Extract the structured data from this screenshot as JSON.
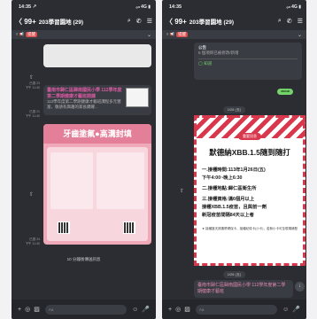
{
  "left": {
    "status_time": "14:35 ↗",
    "status_right": "ₒₗₗ 4G ▮",
    "header": {
      "back": "〈 99+",
      "title": "203學習園地 (29)",
      "search": "⌕",
      "call": "✆",
      "menu": "☰"
    },
    "notice": {
      "text": "▿ 📢",
      "tag": "提醒",
      "chevron": "⌄"
    },
    "ts1": "已讀 23\n下午 11:40",
    "news": {
      "title": "臺南市歸仁區歸南國民小學 112學年度第二學期健康才藝班開課",
      "body": "112學年度第二學期健康才藝班課程多元豐富，敬請有興趣的家長踴躍...",
      "share": "⇧"
    },
    "ts2": "已讀 21\n下午 11:40",
    "poster_title": "牙齒塗氟●高溝封填",
    "note": "10 分鐘後傳送訊息",
    "ts3": "已讀 24\n下午 11:40",
    "bottom": {
      "plus": "+",
      "camera": "◎",
      "image": "▨",
      "input": "Aa",
      "emoji": "☺",
      "mic": "🎤"
    }
  },
  "right": {
    "status_time": "14:35",
    "status_right": "ₒₗₗ 4G ▮",
    "header": {
      "back": "〈 99+",
      "title": "203學習園地 (29)",
      "search": "⌕",
      "call": "✆",
      "menu": "☰"
    },
    "notice": {
      "text": "▿ 📢",
      "tag": "提醒",
      "chevron": "⌄"
    },
    "top_msg_title": "公告",
    "top_msg_body": "5 個項目已被修改/新增",
    "ok_label": "◯ 知道",
    "green_bubble": "ᵒᵏᵒᵏᵒᵏ",
    "date1": "1/26 (五)",
    "poster": {
      "pill": "重要訊息",
      "headline": "默德納XBB.1.5隨到隨打",
      "lines": [
        "一.接種時間:113年1月26日(五)",
        "    下午4:00~晚上6:30",
        "二.接種地點:歸仁區衛生所",
        "三.接種資格:滿6個月以上",
        "接種XBB.1.5疫苗，且與前一劑",
        "新冠疫苗間隔84天以上者"
      ],
      "small": "★ 接種當天請攜帶健保卡、接種紀錄卡(小卡)，若無小卡可至現場補發"
    },
    "date2": "1/26 (五)",
    "red_news": "臺南市歸仁區歸南國民小學 112學年度第二學期健康才藝班",
    "ts_r": "已讀 24\n下午 11:40",
    "scroll": "↓",
    "bottom": {
      "plus": "+",
      "camera": "◎",
      "image": "▨",
      "input": "Aa",
      "emoji": "☺",
      "mic": "🎤"
    }
  }
}
